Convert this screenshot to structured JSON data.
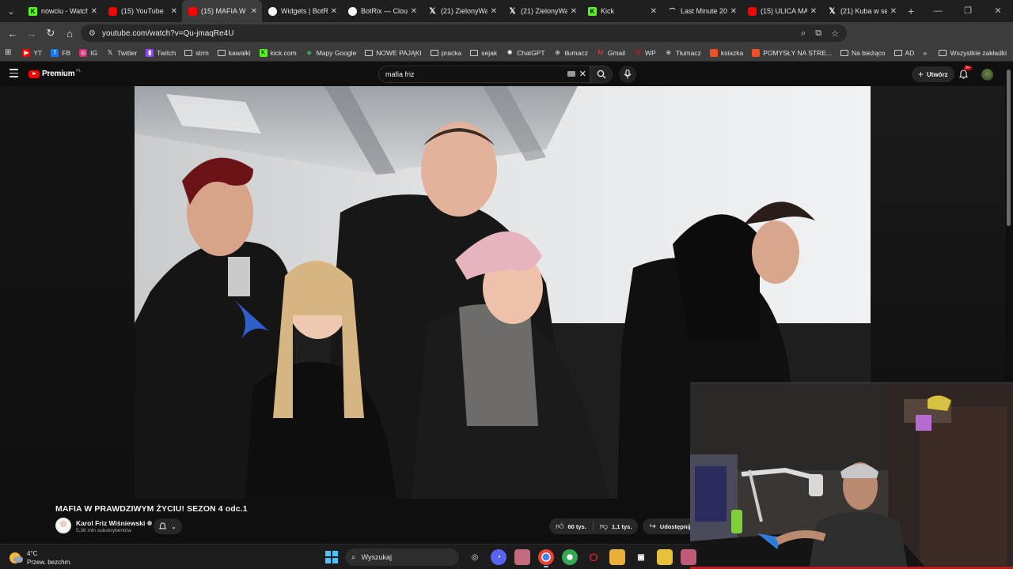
{
  "browser": {
    "tabs": [
      {
        "title": "nowciu - Watch",
        "favicon": "kick-icon",
        "active": false
      },
      {
        "title": "(15) YouTube",
        "favicon": "youtube-icon",
        "active": false
      },
      {
        "title": "(15) MAFIA W P",
        "favicon": "youtube-icon",
        "active": true
      },
      {
        "title": "Widgets | BotR",
        "favicon": "botrix-icon",
        "active": false
      },
      {
        "title": "BotRix — Clou",
        "favicon": "botrix-icon",
        "active": false
      },
      {
        "title": "(21) ZielonyWa",
        "favicon": "x-icon",
        "active": false
      },
      {
        "title": "(21) ZielonyWa",
        "favicon": "x-icon",
        "active": false
      },
      {
        "title": "Kick",
        "favicon": "kick-icon",
        "active": false
      },
      {
        "title": "Last Minute 20",
        "favicon": "lastminute-icon",
        "active": false
      },
      {
        "title": "(15) ULICA MA",
        "favicon": "youtube-icon",
        "active": false
      },
      {
        "title": "(21) Kuba w se",
        "favicon": "x-icon",
        "active": false
      }
    ],
    "new_tab": "+",
    "url": "youtube.com/watch?v=Qu-jmaqRe4U",
    "bookmarks": [
      {
        "label": "YT",
        "icon": "youtube-icon"
      },
      {
        "label": "FB",
        "icon": "facebook-icon"
      },
      {
        "label": "IG",
        "icon": "instagram-icon"
      },
      {
        "label": "Twitter",
        "icon": "x-icon"
      },
      {
        "label": "Twitch",
        "icon": "twitch-icon"
      },
      {
        "label": "strm",
        "icon": "folder-icon"
      },
      {
        "label": "kawałki",
        "icon": "folder-icon"
      },
      {
        "label": "kick.com",
        "icon": "kick-icon"
      },
      {
        "label": "Mapy Google",
        "icon": "maps-icon"
      },
      {
        "label": "NOWE PAJĄKI",
        "icon": "folder-icon"
      },
      {
        "label": "pracka",
        "icon": "folder-icon"
      },
      {
        "label": "sejak",
        "icon": "folder-icon"
      },
      {
        "label": "ChatGPT",
        "icon": "chatgpt-icon"
      },
      {
        "label": "tłumacz",
        "icon": "translate-icon"
      },
      {
        "label": "Gmail",
        "icon": "gmail-icon"
      },
      {
        "label": "WP",
        "icon": "wp-icon"
      },
      {
        "label": "Tłumacz",
        "icon": "translate-icon"
      },
      {
        "label": "ksiazka",
        "icon": "microsoft-icon"
      },
      {
        "label": "POMYSŁY NA STRE...",
        "icon": "microsoft-icon"
      },
      {
        "label": "Na bieżąco",
        "icon": "folder-icon"
      },
      {
        "label": "AD",
        "icon": "folder-icon"
      }
    ],
    "bookmarks_overflow": "»",
    "all_bookmarks": "Wszystkie zakładki"
  },
  "youtube": {
    "logo_text": "Premium",
    "logo_superscript": "PL",
    "search_query": "mafia friz",
    "create_label": "Utwórz",
    "notification_badge": "9+",
    "video_title": "MAFIA W PRAWDZIWYM ŻYCIU! SEZON 4 odc.1",
    "channel_name": "Karol Friz Wiśniewski",
    "subscribers": "5,36 mln subskrybentów",
    "likes": "60 tys.",
    "dislikes": "1,1 tys.",
    "share_label": "Udostępnij"
  },
  "taskbar": {
    "temperature": "4°C",
    "weather_desc": "Przew. bezchm.",
    "search_label": "Wyszukaj"
  },
  "colors": {
    "youtube_red": "#ff0000",
    "kick_green": "#53fc18",
    "windows_blue": "#4cc2ff"
  }
}
